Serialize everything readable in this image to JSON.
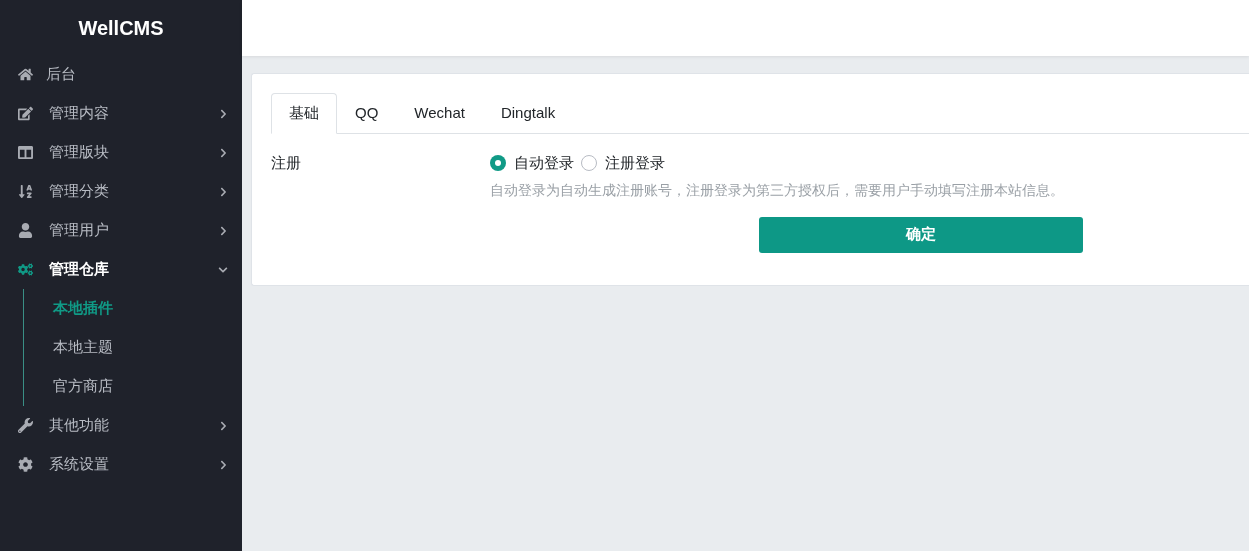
{
  "sidebar": {
    "title": "WellCMS",
    "items": [
      {
        "label": "后台",
        "kind": "link"
      },
      {
        "label": "管理内容",
        "kind": "group",
        "expanded": false
      },
      {
        "label": "管理版块",
        "kind": "group",
        "expanded": false
      },
      {
        "label": "管理分类",
        "kind": "group",
        "expanded": false
      },
      {
        "label": "管理用户",
        "kind": "group",
        "expanded": false
      },
      {
        "label": "管理仓库",
        "kind": "group",
        "expanded": true,
        "children": [
          {
            "label": "本地插件",
            "selected": true
          },
          {
            "label": "本地主题",
            "selected": false
          },
          {
            "label": "官方商店",
            "selected": false
          }
        ]
      },
      {
        "label": "其他功能",
        "kind": "group",
        "expanded": false
      },
      {
        "label": "系统设置",
        "kind": "group",
        "expanded": false
      }
    ]
  },
  "tabs": [
    {
      "label": "基础",
      "selected": true
    },
    {
      "label": "QQ",
      "selected": false
    },
    {
      "label": "Wechat",
      "selected": false
    },
    {
      "label": "Dingtalk",
      "selected": false
    }
  ],
  "form": {
    "label": "注册",
    "options": [
      {
        "label": "自动登录",
        "selected": true
      },
      {
        "label": "注册登录",
        "selected": false
      }
    ],
    "help": "自动登录为自动生成注册账号，注册登录为第三方授权后，需要用户手动填写注册本站信息。",
    "submit": "确定"
  }
}
